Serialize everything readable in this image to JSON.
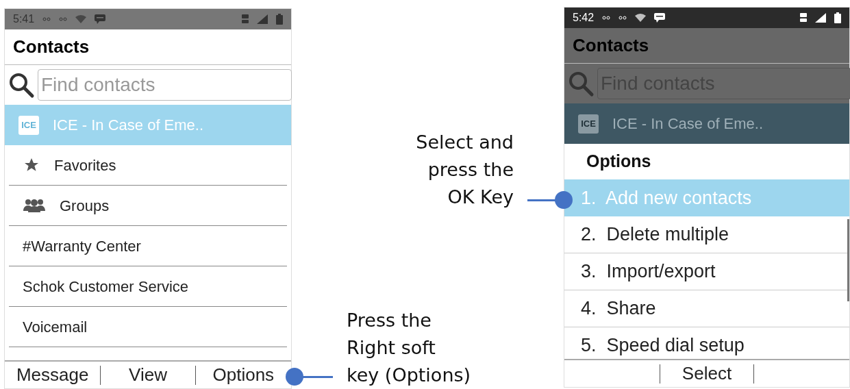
{
  "screens": [
    {
      "status_bar": {
        "time": "5:41"
      },
      "dimmed": false,
      "title": "Contacts",
      "search": {
        "placeholder": "Find contacts"
      },
      "contacts": [
        {
          "label": "ICE - In Case of Eme..",
          "kind": "ice",
          "badge": "ICE",
          "selected": true
        },
        {
          "label": "Favorites",
          "kind": "star",
          "selected": false
        },
        {
          "label": "Groups",
          "kind": "group",
          "selected": false
        },
        {
          "label": "#Warranty Center",
          "selected": false
        },
        {
          "label": "Schok Customer Service",
          "selected": false
        },
        {
          "label": "Voicemail",
          "selected": false
        }
      ],
      "soft_keys": [
        "Message",
        "View",
        "Options"
      ]
    },
    {
      "status_bar": {
        "time": "5:42"
      },
      "dimmed": true,
      "title": "Contacts",
      "search": {
        "placeholder": "Find contacts"
      },
      "contacts": [
        {
          "label": "ICE - In Case of Eme..",
          "kind": "ice",
          "badge": "ICE",
          "selected": true
        }
      ],
      "options_menu": {
        "title": "Options",
        "items": [
          {
            "label": "1.  Add new contacts",
            "selected": true
          },
          {
            "label": "2.  Delete multiple",
            "selected": false
          },
          {
            "label": "3.  Import/export",
            "selected": false
          },
          {
            "label": "4.  Share",
            "selected": false
          },
          {
            "label": "5.  Speed dial setup",
            "selected": false
          }
        ]
      },
      "soft_keys": [
        "Select"
      ]
    }
  ],
  "annotations": [
    {
      "text": "Select and\npress the\nOK Key"
    },
    {
      "text": "Press the\nRight soft\nkey (Options)"
    }
  ]
}
